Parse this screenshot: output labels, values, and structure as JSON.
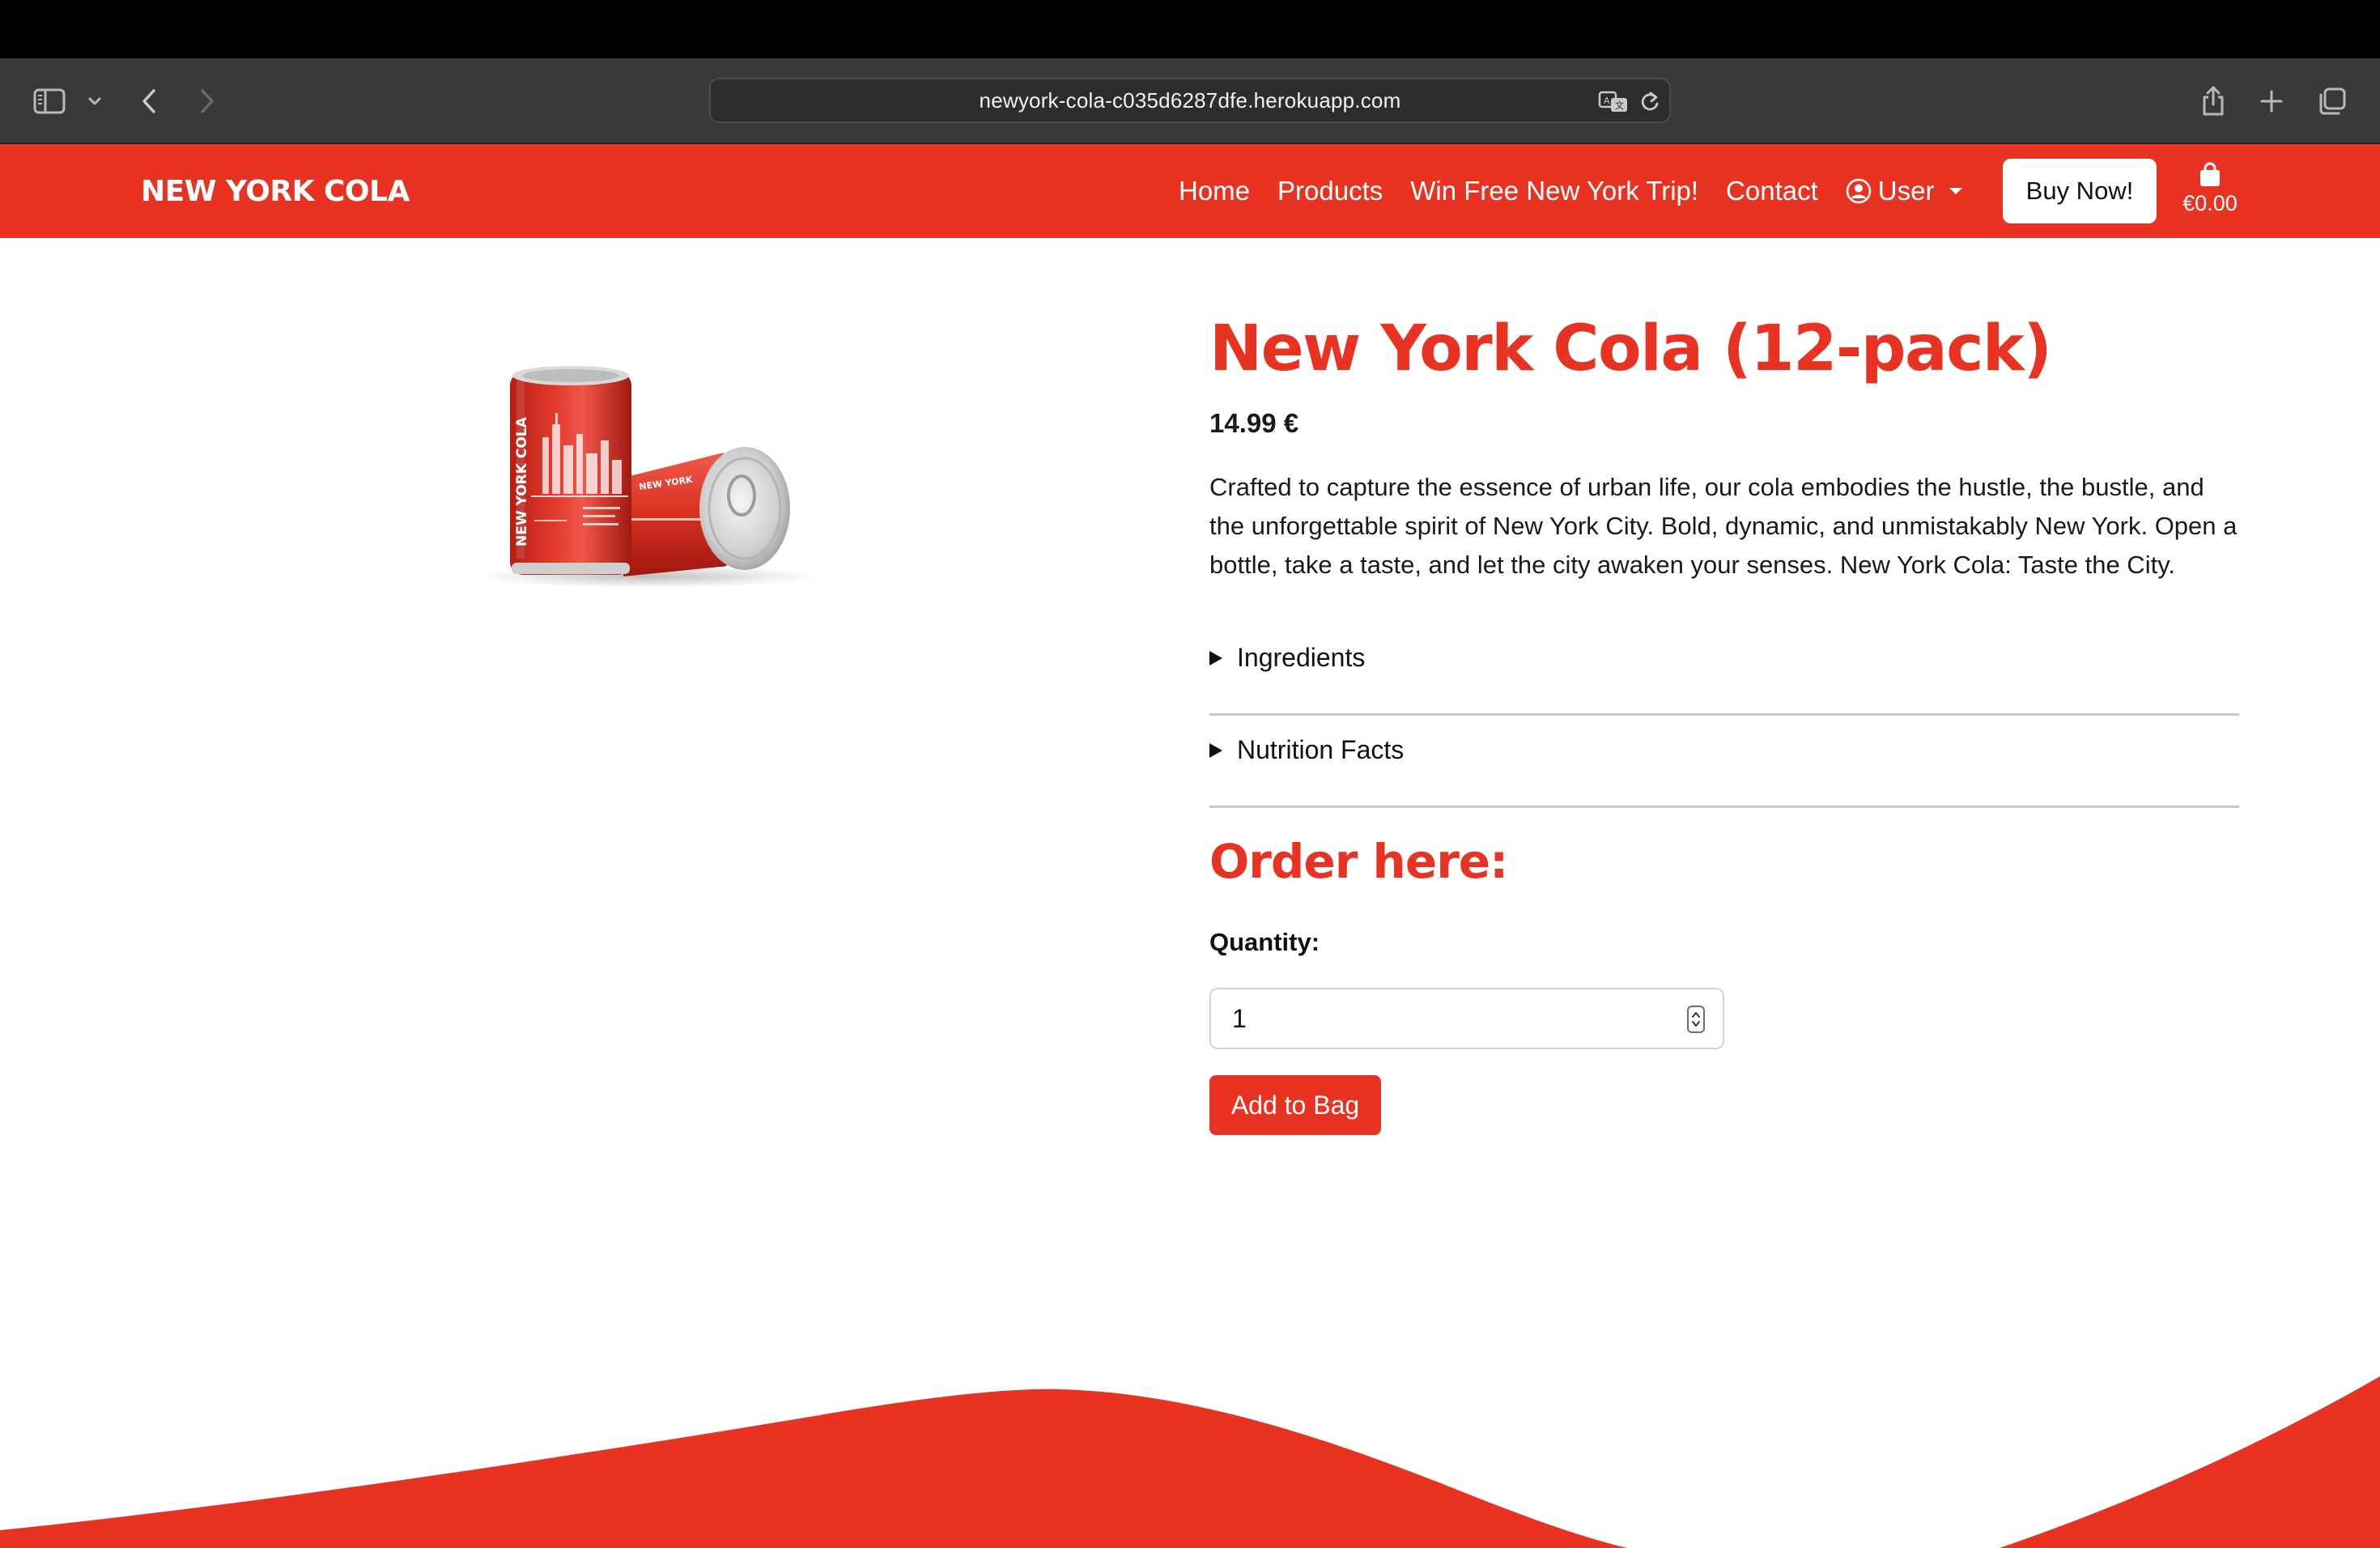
{
  "colors": {
    "brand_red": "#e83323",
    "browser_toolbar": "#38393b"
  },
  "browser": {
    "url": "newyork-cola-c035d6287dfe.herokuapp.com",
    "icons": [
      "sidebar-icon",
      "chevron-down-icon",
      "back-arrow-icon",
      "forward-arrow-icon",
      "translate-icon",
      "reload-icon",
      "share-icon",
      "plus-icon",
      "tabs-overview-icon"
    ]
  },
  "nav": {
    "brand": "NEW YORK COLA",
    "links": {
      "home": "Home",
      "products": "Products",
      "trip": "Win Free New York Trip!",
      "contact": "Contact"
    },
    "user_label": "User",
    "buy_now": "Buy Now!",
    "bag_total": "€0.00"
  },
  "product": {
    "title": "New York Cola (12-pack)",
    "price": "14.99 €",
    "description": "Crafted to capture the essence of urban life, our cola embodies the hustle, the bustle, and the unforgettable spirit of New York City. Bold, dynamic, and unmistakably New York. Open a bottle, take a taste, and let the city awaken your senses. New York Cola: Taste the City.",
    "can_text": "NEW YORK COLA",
    "sections": {
      "ingredients": "Ingredients",
      "nutrition": "Nutrition Facts"
    }
  },
  "order": {
    "heading": "Order here:",
    "quantity_label": "Quantity:",
    "quantity_value": "1",
    "add_button": "Add to Bag"
  }
}
